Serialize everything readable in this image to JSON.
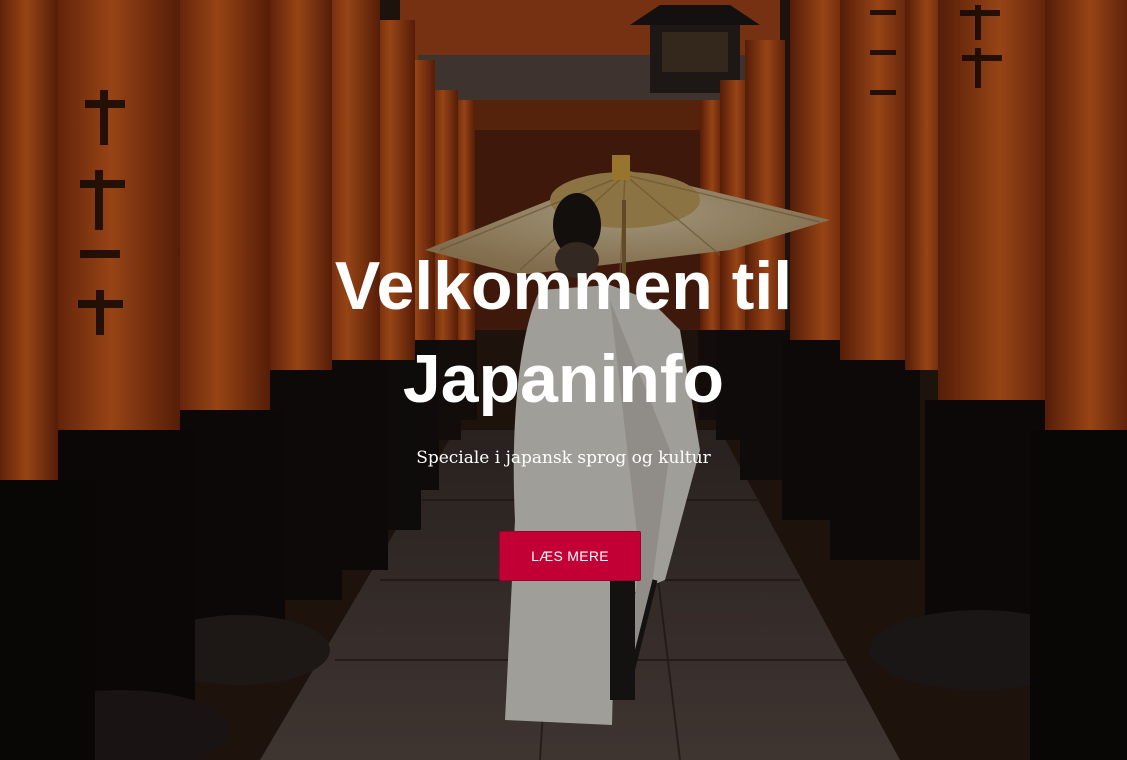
{
  "hero": {
    "title_line1": "Velkommen til",
    "title_line2": "Japaninfo",
    "subtitle": "Speciale i japansk sprog og kultur",
    "cta_label": "LÆS MERE",
    "background_image": "torii-gate-corridor-with-umbrella-figure-photo"
  },
  "colors": {
    "cta_background": "#c30035",
    "title_text": "#ffffff",
    "torii_orange": "#d45a1c",
    "torii_base_black": "#151010"
  }
}
